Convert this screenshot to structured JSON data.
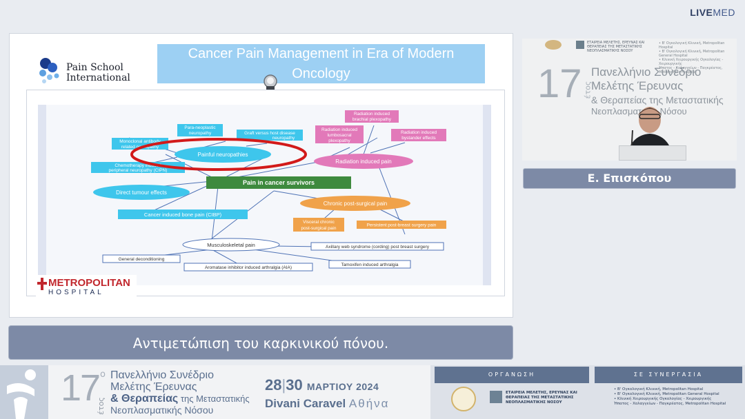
{
  "brand": {
    "bold": "LIVE",
    "light": "MED"
  },
  "slide": {
    "title_line1": "Cancer Pain Management in Era of Modern",
    "title_line2": "Oncology",
    "psi_line1": "Pain School",
    "psi_line2": "International",
    "metro_line1": "METROPOLITAN",
    "metro_line2": "HOSPITAL",
    "diagram": {
      "center": "Pain in cancer survivors",
      "nodes": {
        "painful_neuropathies": "Painful neuropathies",
        "radiation_pain": "Radiation induced pain",
        "direct_tumour": "Direct tumour effects",
        "chronic_post_surgical": "Chronic post-surgical pain",
        "cibp": "Cancer induced bone pain (CIBP)",
        "musculoskeletal": "Musculoskeletal pain",
        "paraneoplastic_1": "Para-neoplastic",
        "paraneoplastic_2": "neuropathy",
        "gvhd_1": "Graft versus host disease",
        "gvhd_2": "neuropathy",
        "monoclonal_1": "Monoclonal antibody",
        "monoclonal_2": "related neuropathy",
        "cipn_1": "Chemotherapy induced",
        "cipn_2": "peripheral neuropathy (CIPN)",
        "brachial_1": "Radiation induced",
        "brachial_2": "brachial plexopathy",
        "lumbosacral_1": "Radiation induced",
        "lumbosacral_2": "lumbosacral",
        "lumbosacral_3": "plexopathy",
        "bystander_1": "Radiation induced",
        "bystander_2": "bystander effects",
        "visceral_1": "Visceral chronic",
        "visceral_2": "post-surgical pain",
        "persistent": "Persistent post-breast surgery pain",
        "axillary": "Axillary web syndrome (cording) post breast surgery",
        "general": "General deconditioning",
        "aromatase": "Aromatase inhibitor induced arthralgia (AIA)",
        "tamoxifen": "Tamoxifen induced arthralgia"
      }
    }
  },
  "video": {
    "number": "17",
    "etos": "έτος",
    "line1": "Πανελλήνιο Συνέδριο",
    "line2": "Μελέτης Έρευνας",
    "line3": "& Θεραπείας της Μεταστατικής",
    "line4": "Νεοπλασματικής Νόσου",
    "org_text": "ΕΤΑΙΡΕΙΑ ΜΕΛΕΤΗΣ, ΕΡΕΥΝΑΣ ΚΑΙ ΘΕΡΑΠΕΙΑΣ ΤΗΣ ΜΕΤΑΣΤΑΤΙΚΗΣ ΝΕΟΠΛΑΣΜΑΤΙΚΗΣ ΝΟΣΟΥ",
    "small_1": "• Β' Ογκολογική Κλινική, Metropolitan Hospital",
    "small_2": "• Β' Ογκολογική Κλινική, Metropolitan General Hospital",
    "small_3": "• Κλινική Χειρουργικής Ογκολογίας - Χειρουργικής",
    "small_4": "Ήπατος - Χολαγγείων - Παγκρέατος, Metropolitan Hospital"
  },
  "speaker_name": "Ε. Επισκόπου",
  "subtitle": "Αντιμετώπιση του καρκινικού πόνου.",
  "banner": {
    "number": "17",
    "degree": "ο",
    "etos": "έτος",
    "line1": "Πανελλήνιο Συνέδριο",
    "line2": "Μελέτης Έρευνας",
    "line3a": "& Θεραπείας",
    "line3b": " της Μεταστατικής",
    "line4": "Νεοπλασματικής Νόσου",
    "date_a": "28",
    "date_b": "30",
    "month": "ΜΑΡΤΙΟΥ 2024",
    "venue": "Divani Caravel",
    "city": "Αθήνα",
    "organization_head": "ΟΡΓΑΝΩΣΗ",
    "partnership_head": "ΣΕ ΣΥΝΕΡΓΑΣΙΑ",
    "org_text": "ΕΤΑΙΡΕΙΑ ΜΕΛΕΤΗΣ, ΕΡΕΥΝΑΣ ΚΑΙ ΘΕΡΑΠΕΙΑΣ ΤΗΣ ΜΕΤΑΣΤΑΤΙΚΗΣ ΝΕΟΠΛΑΣΜΑΤΙΚΗΣ ΝΟΣΟΥ",
    "partner_1": "• Β' Ογκολογική Κλινική, Metropolitan Hospital",
    "partner_2": "• Β' Ογκολογική Κλινική, Metropolitan General Hospital",
    "partner_3": "• Κλινική Χειρουργικής Ογκολογίας - Χειρουργικής",
    "partner_4": "Ήπατος - Χολαγγείων - Παγκρέατος, Metropolitan Hospital"
  },
  "colors": {
    "accent": "#7d8aa6",
    "title_bg": "#9dd0f3",
    "node_cyan": "#3ec6ec",
    "node_pink": "#e279b9",
    "node_orange": "#f0a24a",
    "node_green": "#3e8a3e",
    "highlight_red": "#d21a1a"
  }
}
